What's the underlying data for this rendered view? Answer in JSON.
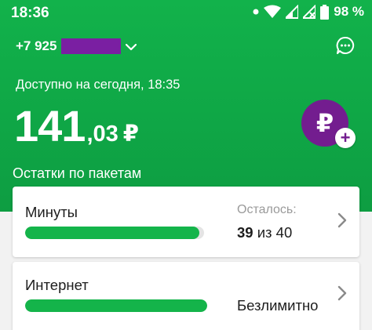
{
  "status_bar": {
    "time": "18:36",
    "battery": "98 %",
    "icons": [
      "wifi-icon",
      "signal-icon",
      "signal-no-data-icon",
      "battery-icon"
    ]
  },
  "account": {
    "phone_prefix": "+7 925"
  },
  "balance": {
    "available_label": "Доступно на сегодня, 18:35",
    "integer": "141",
    "fraction": ",03",
    "currency": "₽"
  },
  "topup": {
    "symbol": "₽",
    "plus": "+"
  },
  "packages": {
    "title": "Остатки по пакетам",
    "items": [
      {
        "label": "Минуты",
        "remaining_label": "Осталось:",
        "remaining": "39",
        "of": "из 40",
        "fill_fraction": 0.975
      },
      {
        "label": "Интернет",
        "status": "Безлимитно",
        "fill_fraction": 1.0
      }
    ]
  },
  "colors": {
    "brand_green": "#12b24b",
    "brand_purple": "#731d8f"
  }
}
